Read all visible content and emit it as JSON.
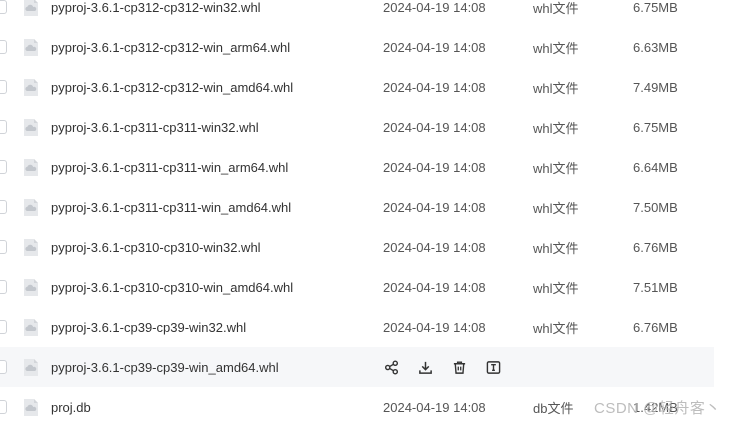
{
  "files": [
    {
      "name": "pyproj-3.6.1-cp312-cp312-win32.whl",
      "date": "2024-04-19 14:08",
      "type": "whl文件",
      "size": "6.75MB"
    },
    {
      "name": "pyproj-3.6.1-cp312-cp312-win_arm64.whl",
      "date": "2024-04-19 14:08",
      "type": "whl文件",
      "size": "6.63MB"
    },
    {
      "name": "pyproj-3.6.1-cp312-cp312-win_amd64.whl",
      "date": "2024-04-19 14:08",
      "type": "whl文件",
      "size": "7.49MB"
    },
    {
      "name": "pyproj-3.6.1-cp311-cp311-win32.whl",
      "date": "2024-04-19 14:08",
      "type": "whl文件",
      "size": "6.75MB"
    },
    {
      "name": "pyproj-3.6.1-cp311-cp311-win_arm64.whl",
      "date": "2024-04-19 14:08",
      "type": "whl文件",
      "size": "6.64MB"
    },
    {
      "name": "pyproj-3.6.1-cp311-cp311-win_amd64.whl",
      "date": "2024-04-19 14:08",
      "type": "whl文件",
      "size": "7.50MB"
    },
    {
      "name": "pyproj-3.6.1-cp310-cp310-win32.whl",
      "date": "2024-04-19 14:08",
      "type": "whl文件",
      "size": "6.76MB"
    },
    {
      "name": "pyproj-3.6.1-cp310-cp310-win_amd64.whl",
      "date": "2024-04-19 14:08",
      "type": "whl文件",
      "size": "7.51MB"
    },
    {
      "name": "pyproj-3.6.1-cp39-cp39-win32.whl",
      "date": "2024-04-19 14:08",
      "type": "whl文件",
      "size": "6.76MB"
    },
    {
      "name": "pyproj-3.6.1-cp39-cp39-win_amd64.whl"
    },
    {
      "name": "proj.db",
      "date": "2024-04-19 14:08",
      "type": "db文件",
      "size": "1.42MB"
    }
  ],
  "hovered_row_actions": [
    "share-icon",
    "download-icon",
    "delete-icon",
    "rename-icon"
  ],
  "watermark": "CSDN @轻舟客丶",
  "colors": {
    "hover_bg": "#f6f7f9",
    "icon_gray": "#c8ccd2",
    "action_icon": "#333333"
  }
}
